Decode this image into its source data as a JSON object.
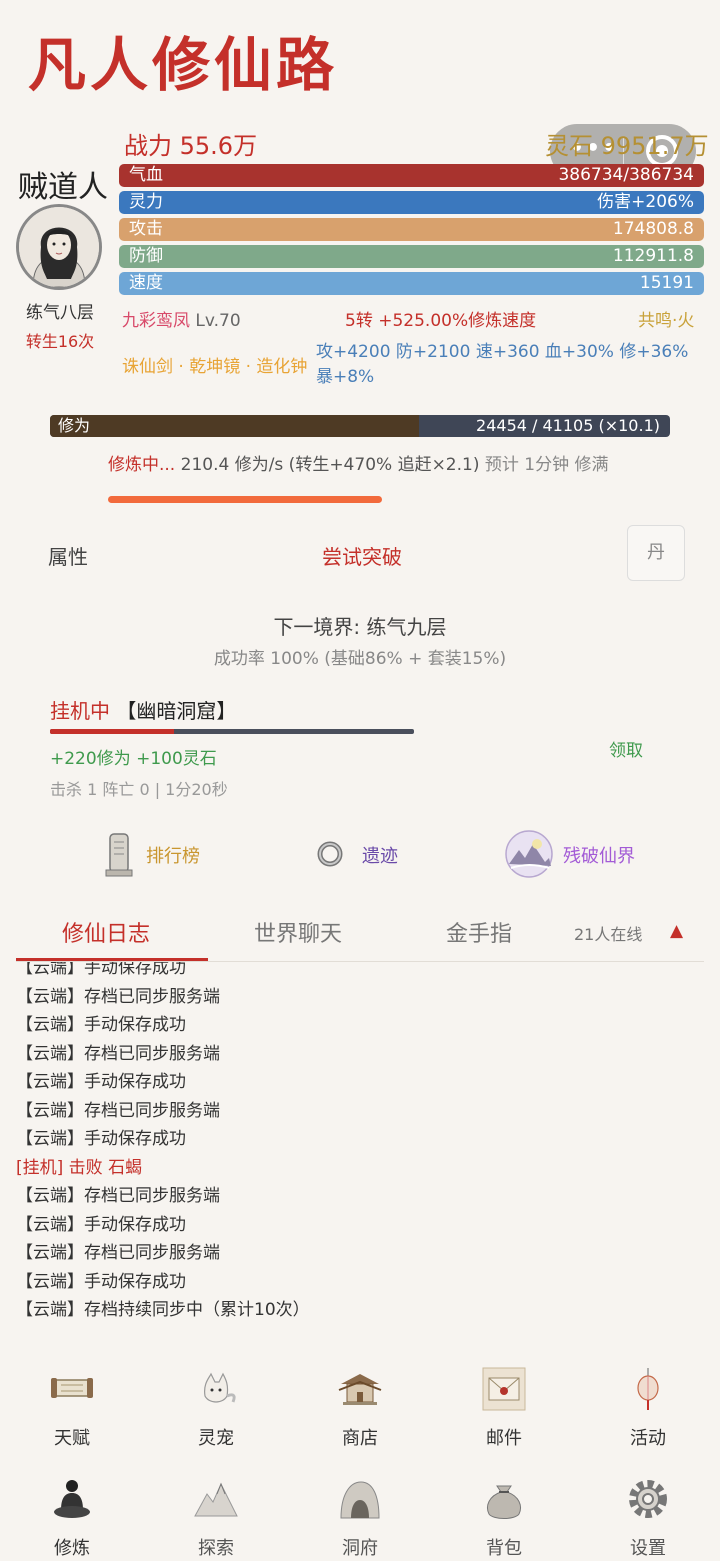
{
  "app": {
    "title": "凡人修仙路"
  },
  "header": {
    "power": "战力 55.6万",
    "lingshi": "灵石 9951.7万"
  },
  "player": {
    "name": "贼道人",
    "realm": "练气八层",
    "rebirth": "转生16次",
    "stats": [
      {
        "label": "气血",
        "value": "386734/386734",
        "color": "#a8332e"
      },
      {
        "label": "灵力",
        "value": "伤害+206%",
        "color": "#3b78be"
      },
      {
        "label": "攻击",
        "value": "174808.8",
        "color": "#d8a16d"
      },
      {
        "label": "防御",
        "value": "112911.8",
        "color": "#7fa98a"
      },
      {
        "label": "速度",
        "value": "15191",
        "color": "#6ea6d6"
      }
    ],
    "pet_name": "九彩鸾凤",
    "pet_level": "Lv.70",
    "rebirth_bonus": "5转 +525.00%修炼速度",
    "resonance": "共鸣·火",
    "equipment": "诛仙剑 · 乾坤镜 · 造化钟",
    "equip_bonus": "攻+4200 防+2100 速+360 血+30% 修+36% 暴+8%"
  },
  "cultivation": {
    "label": "修为",
    "value": "24454 / 41105 (×10.1)",
    "progress": 0.595,
    "status_active": "修炼中...",
    "status_rate": " 210.4 修为/s (转生+470% 追赶×2.1) ",
    "status_eta": "预计 1分钟 修满"
  },
  "breakthrough": {
    "attr_label": "属性",
    "button": "尝试突破",
    "dan": "丹",
    "next_realm": "下一境界: 练气九层",
    "success_rate": "成功率 100% (基础86% + 套装15%)"
  },
  "idle": {
    "status": "挂机中",
    "location": " 【幽暗洞窟】",
    "progress": 0.34,
    "rewards": "+220修为  +100灵石",
    "claim": "领取",
    "stats": "击杀 1  阵亡 0  |  1分20秒"
  },
  "features": [
    {
      "label": "排行榜",
      "icon": "stele-icon"
    },
    {
      "label": "遗迹",
      "icon": "ring-icon"
    },
    {
      "label": "残破仙界",
      "icon": "mountain-orb-icon"
    }
  ],
  "tabs": {
    "log": "修仙日志",
    "chat": "世界聊天",
    "cheat": "金手指",
    "online": "21人在线",
    "collapse": "▲"
  },
  "log": [
    "【云端】手动保存成功",
    "【云端】存档已同步服务端",
    "【云端】手动保存成功",
    "【云端】存档已同步服务端",
    "【云端】手动保存成功",
    "【云端】存档已同步服务端",
    "【云端】手动保存成功",
    "[挂机] 击败 石蝎",
    "【云端】存档已同步服务端",
    "【云端】手动保存成功",
    "【云端】存档已同步服务端",
    "【云端】手动保存成功",
    "【云端】存档持续同步中（累计10次）"
  ],
  "nav_row1": [
    "天赋",
    "灵宠",
    "商店",
    "邮件",
    "活动"
  ],
  "nav_row2": [
    "修炼",
    "探索",
    "洞府",
    "背包",
    "设置"
  ]
}
